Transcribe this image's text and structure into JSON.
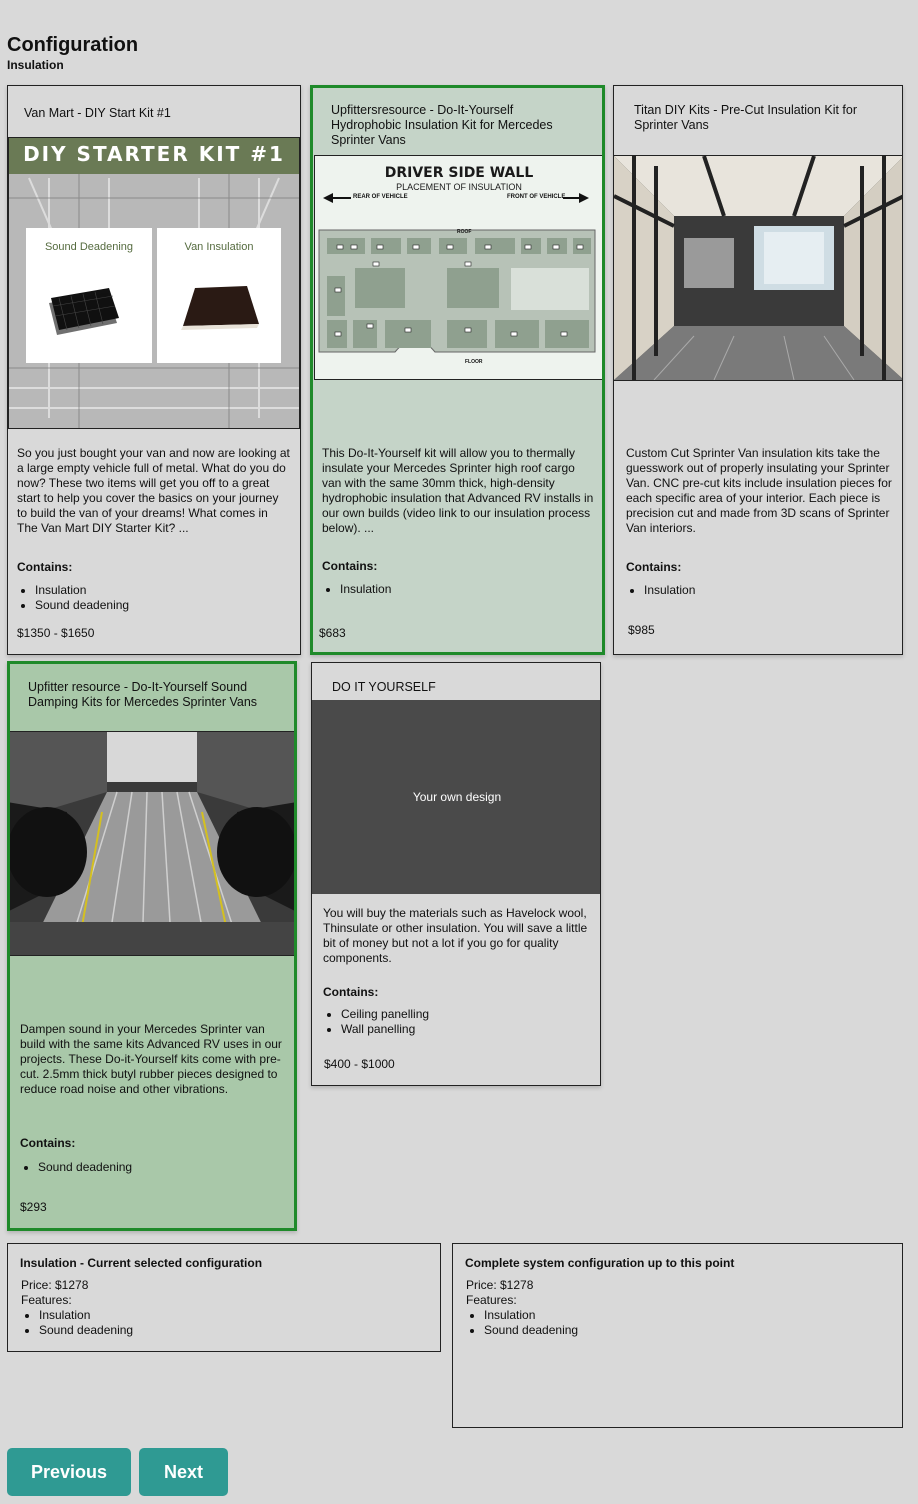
{
  "header": {
    "title": "Configuration",
    "subtitle": "Insulation"
  },
  "cards": [
    {
      "title": "Van Mart - DIY Start Kit #1",
      "image": {
        "banner": "DIY STARTER KIT #1",
        "label_left": "Sound Deadening",
        "label_right": "Van Insulation"
      },
      "description": "So you just bought your van and now are looking at a large empty vehicle full of metal. What do you do now? These two items will get you off to a great start to help you cover the basics on your journey to build the van of your dreams! What comes in The Van Mart DIY Starter Kit? ...",
      "contains_label": "Contains:",
      "items": [
        "Insulation",
        "Sound deadening"
      ],
      "price": "$1350 - $1650",
      "selected": false
    },
    {
      "title": "Upfittersresource - Do-It-Yourself Hydrophobic Insulation Kit for Mercedes Sprinter Vans",
      "image": {
        "heading": "DRIVER SIDE WALL",
        "subheading": "PLACEMENT OF INSULATION",
        "left_arrow": "REAR OF VEHICLE",
        "right_arrow": "FRONT OF VEHICLE",
        "roof": "ROOF",
        "floor": "FLOOR"
      },
      "description": "This Do-It-Yourself kit will allow you to thermally insulate your Mercedes Sprinter high roof cargo van with the same 30mm thick, high-density hydrophobic insulation that Advanced RV installs in our own builds (video link to our insulation process below). ...",
      "contains_label": "Contains:",
      "items": [
        "Insulation"
      ],
      "price": "$683",
      "selected": true
    },
    {
      "title": "Titan DIY Kits - Pre-Cut Insulation Kit for Sprinter Vans",
      "description": "Custom Cut Sprinter Van insulation kits take the guesswork out of properly insulating your Sprinter Van. CNC pre-cut kits include insulation pieces for each specific area of your interior. Each piece is precision cut and made from 3D scans of Sprinter Van interiors.",
      "contains_label": "Contains:",
      "items": [
        "Insulation"
      ],
      "price": "$985",
      "selected": false
    },
    {
      "title": "Upfitter resource - Do-It-Yourself Sound Damping Kits for Mercedes Sprinter Vans",
      "description": "Dampen sound in your Mercedes Sprinter van build with the same kits Advanced RV uses in our projects. These Do-it-Yourself kits come with pre-cut. 2.5mm thick butyl rubber pieces designed to reduce road noise and other vibrations.",
      "contains_label": "Contains:",
      "items": [
        "Sound deadening"
      ],
      "price": "$293",
      "selected": true
    },
    {
      "title": "DO IT YOURSELF",
      "image": {
        "placeholder": "Your own design"
      },
      "description": "You will buy the materials such as Havelock wool, Thinsulate or other insulation. You will save a little bit of money but not a lot if you go for quality components.",
      "contains_label": "Contains:",
      "items": [
        "Ceiling panelling",
        "Wall panelling"
      ],
      "price": "$400 - $1000",
      "selected": false
    }
  ],
  "summary_current": {
    "title": "Insulation - Current selected configuration",
    "price": "Price: $1278",
    "features_label": "Features:",
    "features": [
      "Insulation",
      "Sound deadening"
    ]
  },
  "summary_complete": {
    "title": "Complete system configuration up to this point",
    "price": "Price: $1278",
    "features_label": "Features:",
    "features": [
      "Insulation",
      "Sound deadening"
    ]
  },
  "nav": {
    "previous": "Previous",
    "next": "Next"
  },
  "colors": {
    "selected_border": "#1f8a2a",
    "selected_fill_1": "#c5d4c8",
    "selected_fill_2": "#a9c8a9",
    "button": "#2f9a93"
  }
}
